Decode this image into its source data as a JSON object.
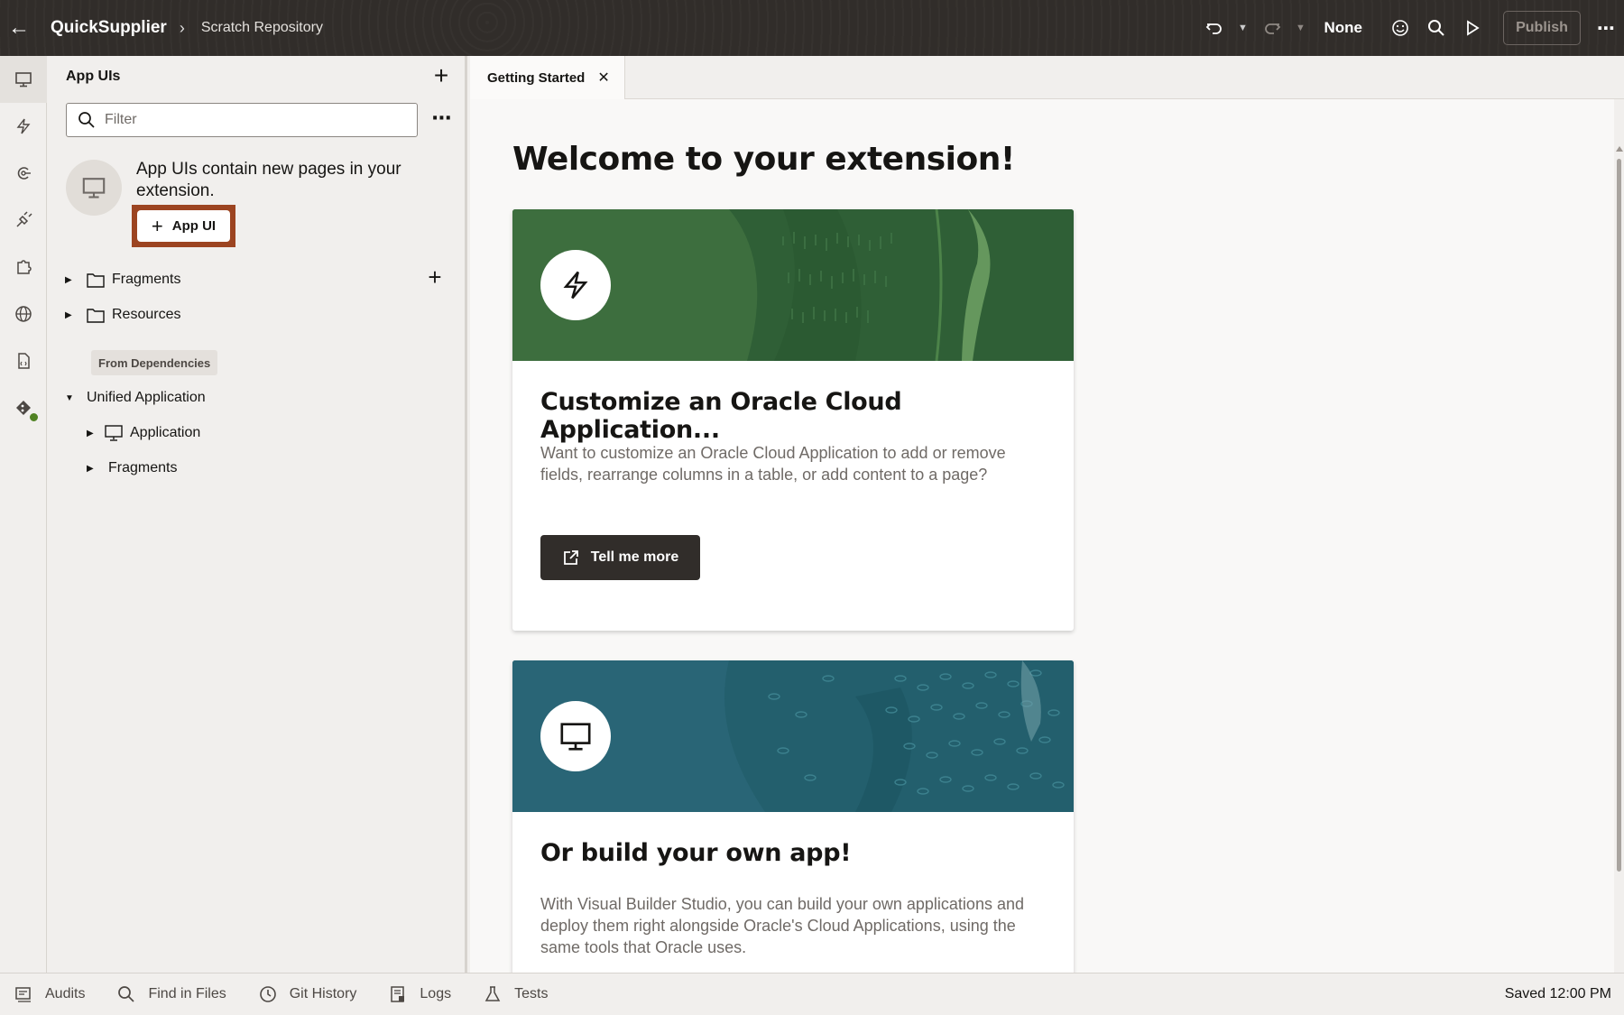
{
  "header": {
    "app_name": "QuickSupplier",
    "repository": "Scratch Repository",
    "mode_label": "None",
    "publish_label": "Publish"
  },
  "navigator": {
    "title": "App UIs",
    "filter_placeholder": "Filter",
    "empty_text": "App UIs contain new pages in your extension.",
    "add_app_ui_label": "App UI",
    "tree": {
      "fragments": "Fragments",
      "resources": "Resources",
      "deps_badge": "From Dependencies",
      "unified_application": "Unified Application",
      "application": "Application",
      "fragments_child": "Fragments"
    }
  },
  "editor": {
    "tab_label": "Getting Started",
    "welcome": "Welcome to your extension!",
    "card1": {
      "title": "Customize an Oracle Cloud Application...",
      "description": "Want to customize an Oracle Cloud Application to add or remove fields, rearrange columns in a table, or add content to a page?",
      "button": "Tell me more"
    },
    "card2": {
      "title": "Or build your own app!",
      "description": "With Visual Builder Studio, you can build your own applications and deploy them right alongside Oracle's Cloud Applications, using the same tools that Oracle uses."
    }
  },
  "bottom_bar": {
    "items": [
      "Audits",
      "Find in Files",
      "Git History",
      "Logs",
      "Tests"
    ],
    "status": "Saved 12:00 PM"
  },
  "colors": {
    "header_bg": "#312d2a",
    "highlight": "#9c4421",
    "card1_banner": "#3a6b3c",
    "card2_banner": "#1f5f6e"
  },
  "activity_icons": [
    "monitor-icon",
    "lightning-icon",
    "service-icon",
    "plug-icon",
    "puzzle-icon",
    "globe-icon",
    "document-icon",
    "git-icon"
  ]
}
